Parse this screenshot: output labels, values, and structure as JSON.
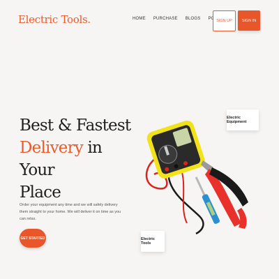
{
  "brand": {
    "logo": "Electric Tools."
  },
  "nav": {
    "items": [
      "HOME",
      "PURCHASE",
      "BLOGS",
      "PORTFOLIO"
    ],
    "signup_label": "SIGN UP",
    "signin_label": "SIGN IN"
  },
  "hero": {
    "headline_line1": "Best & Fastest",
    "headline_accent": "Delivery",
    "headline_line2_rest": " in Your",
    "headline_line3": "Place",
    "description": "Order your equipment any time and we will safely delivery them straight to your home. We will deliver it on time as you can relax.",
    "cta_label": "GET STARTED"
  },
  "cards": {
    "equipment_label": "Electric Equipment",
    "tools_label": "Electric Tools"
  },
  "colors": {
    "accent": "#ec5a2a",
    "background": "#f7f5f3",
    "text_dark": "#1f1f1f"
  }
}
